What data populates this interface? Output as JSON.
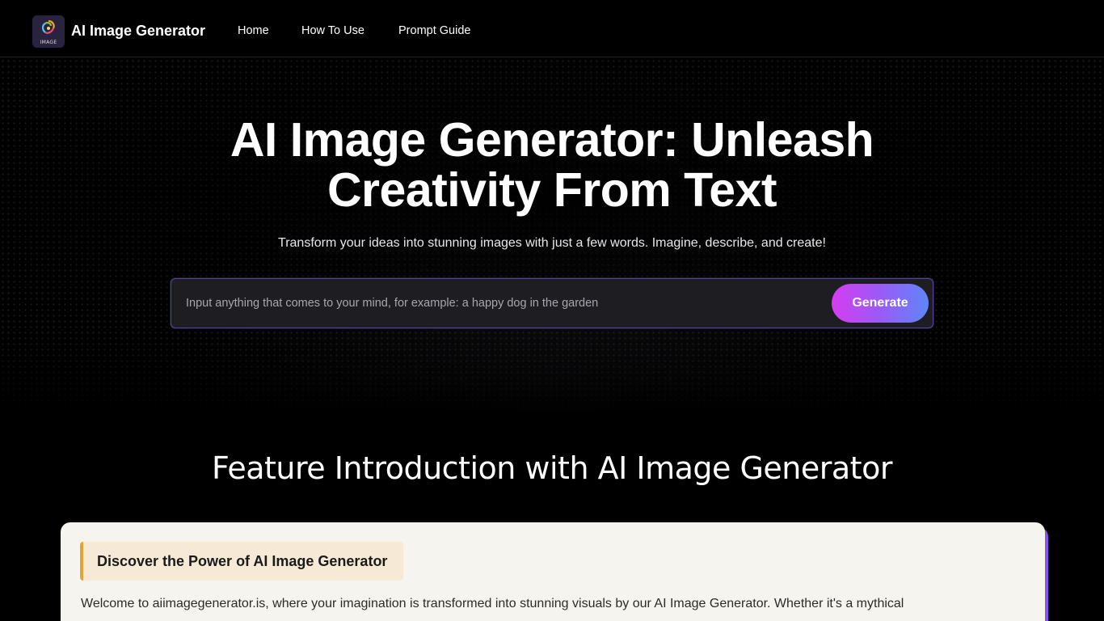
{
  "navbar": {
    "logo_caption": "IMAGE",
    "brand": "AI Image Generator",
    "links": [
      {
        "label": "Home"
      },
      {
        "label": "How To Use"
      },
      {
        "label": "Prompt Guide"
      }
    ]
  },
  "hero": {
    "title_line1": "AI Image Generator: Unleash",
    "title_line2": "Creativity From Text",
    "subtitle": "Transform your ideas into stunning images with just a few words. Imagine, describe, and create!",
    "input_placeholder": "Input anything that comes to your mind, for example: a happy dog in the garden",
    "input_value": "",
    "generate_label": "Generate"
  },
  "feature": {
    "heading": "Feature Introduction with AI Image Generator",
    "card_tag": "Discover the Power of AI Image Generator",
    "card_body": "Welcome to aiimagegenerator.is, where your imagination is transformed into stunning visuals by our AI Image Generator. Whether it's a mythical"
  },
  "colors": {
    "background": "#000000",
    "accent_gradient_start": "#d43df0",
    "accent_gradient_end": "#5f86f8",
    "card_background": "#f6f4ee",
    "card_tag_border": "#e2a436",
    "card_shadow": "#8e4ff0"
  }
}
